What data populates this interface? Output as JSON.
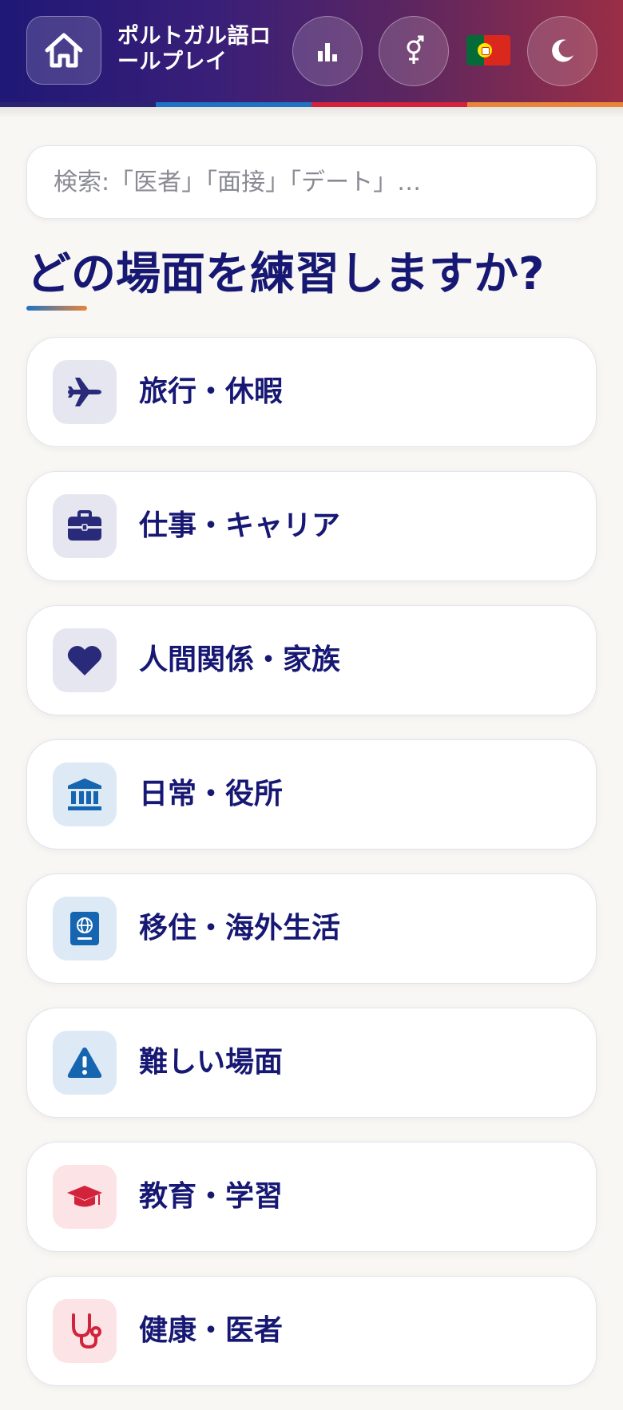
{
  "header": {
    "title": "ポルトガル語ロールプレイ",
    "icons": {
      "home": "home-icon",
      "stats": "bar-chart-icon",
      "gender": "gender-icon",
      "language": "portugal-flag",
      "theme": "moon-icon"
    },
    "stripe_colors": [
      "#2a2470",
      "#1f73c4",
      "#d2233b",
      "#e9853b"
    ]
  },
  "search": {
    "placeholder": "検索:「医者」「面接」「デート」…",
    "value": ""
  },
  "main": {
    "title": "どの場面を練習しますか?"
  },
  "categories": [
    {
      "label": "旅行・休暇",
      "icon": "airplane-icon",
      "icon_color": "#2a2a7a",
      "icon_bg": "#e6e6f0"
    },
    {
      "label": "仕事・キャリア",
      "icon": "briefcase-icon",
      "icon_color": "#2a2a7a",
      "icon_bg": "#e6e6f0"
    },
    {
      "label": "人間関係・家族",
      "icon": "heart-icon",
      "icon_color": "#2a2a7a",
      "icon_bg": "#e6e6f0"
    },
    {
      "label": "日常・役所",
      "icon": "bank-icon",
      "icon_color": "#1565b0",
      "icon_bg": "#ddeaf6"
    },
    {
      "label": "移住・海外生活",
      "icon": "passport-icon",
      "icon_color": "#1565b0",
      "icon_bg": "#ddeaf6"
    },
    {
      "label": "難しい場面",
      "icon": "warning-icon",
      "icon_color": "#1565b0",
      "icon_bg": "#ddeaf6"
    },
    {
      "label": "教育・学習",
      "icon": "graduation-cap-icon",
      "icon_color": "#d2233b",
      "icon_bg": "#fbe3e6"
    },
    {
      "label": "健康・医者",
      "icon": "stethoscope-icon",
      "icon_color": "#d2233b",
      "icon_bg": "#fbe3e6"
    }
  ]
}
